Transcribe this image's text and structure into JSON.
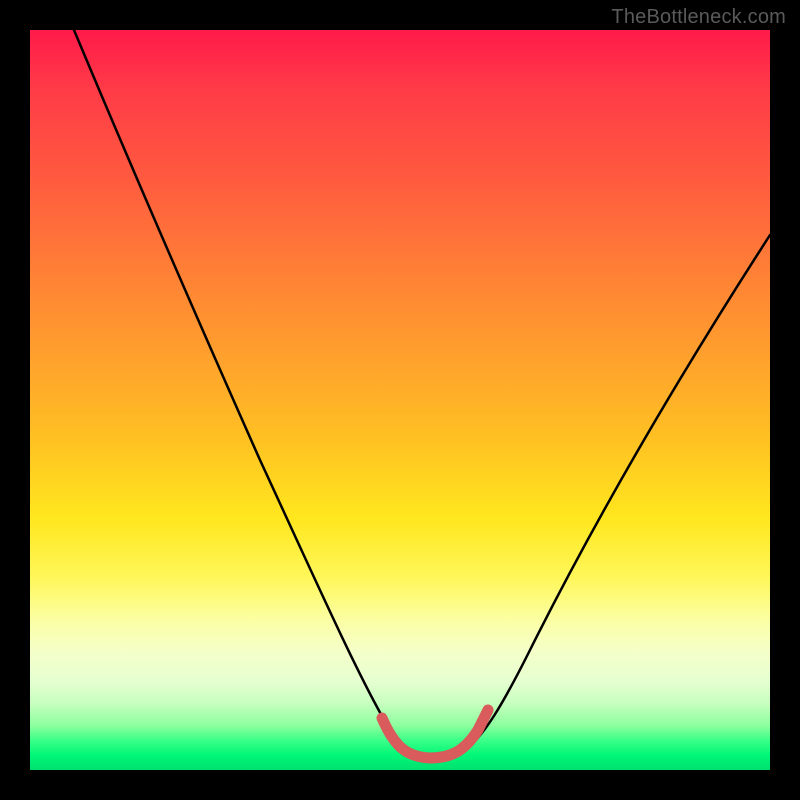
{
  "watermark": "TheBottleneck.com",
  "chart_data": {
    "type": "line",
    "title": "",
    "xlabel": "",
    "ylabel": "",
    "xlim": [
      0,
      100
    ],
    "ylim": [
      0,
      100
    ],
    "series": [
      {
        "name": "bottleneck-curve",
        "x": [
          6,
          10,
          15,
          20,
          25,
          30,
          35,
          40,
          45,
          48,
          50,
          52,
          54,
          56,
          58,
          60,
          62,
          66,
          72,
          80,
          88,
          96,
          100
        ],
        "y": [
          100,
          90,
          79,
          68,
          57,
          46,
          36,
          26,
          14,
          7,
          3.5,
          2.5,
          2.2,
          2.2,
          2.4,
          3,
          5,
          12,
          24,
          40,
          54,
          66,
          72
        ]
      },
      {
        "name": "highlight-segment",
        "x": [
          48,
          50,
          52,
          54,
          56,
          58,
          60,
          62
        ],
        "y": [
          7,
          3.5,
          2.5,
          2.2,
          2.2,
          2.4,
          3,
          5
        ]
      }
    ],
    "colors": {
      "curve": "#000000",
      "highlight": "#d95b5b",
      "gradient_top": "#ff1a4a",
      "gradient_mid": "#ffe71e",
      "gradient_bottom": "#00e070"
    }
  }
}
